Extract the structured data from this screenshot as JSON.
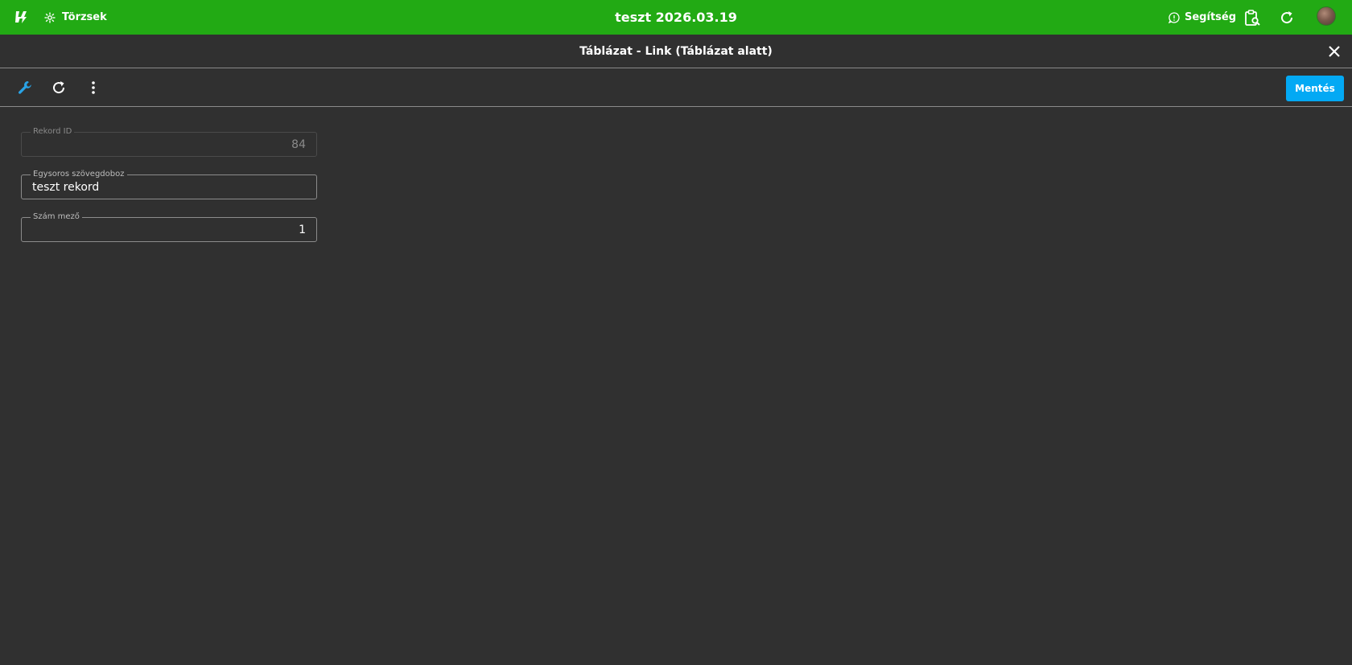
{
  "topbar": {
    "logo_icon": "app-logo-icon",
    "nav_label": "Törzsek",
    "nav_icon": "asterisk-icon",
    "title": "teszt 2026.03.19",
    "help_label": "Segítség",
    "help_icon": "help-chat-icon",
    "clipboard_icon": "clipboard-search-icon",
    "refresh_icon": "refresh-icon",
    "avatar": "user-avatar",
    "bar_color": "#22aa14"
  },
  "dialog": {
    "title": "Táblázat - Link (Táblázat alatt)",
    "close_icon": "close-icon"
  },
  "toolbar": {
    "wrench_icon": "wrench-icon",
    "refresh_icon": "refresh-icon",
    "more_icon": "more-vertical-icon",
    "save_label": "Mentés",
    "save_color": "#03a9f4"
  },
  "form": {
    "record_id": {
      "label": "Rekord ID",
      "value": "84",
      "disabled": true
    },
    "single_line_text": {
      "label": "Egysoros szövegdoboz",
      "value": "teszt rekord"
    },
    "number_field": {
      "label": "Szám mező",
      "value": "1"
    }
  }
}
